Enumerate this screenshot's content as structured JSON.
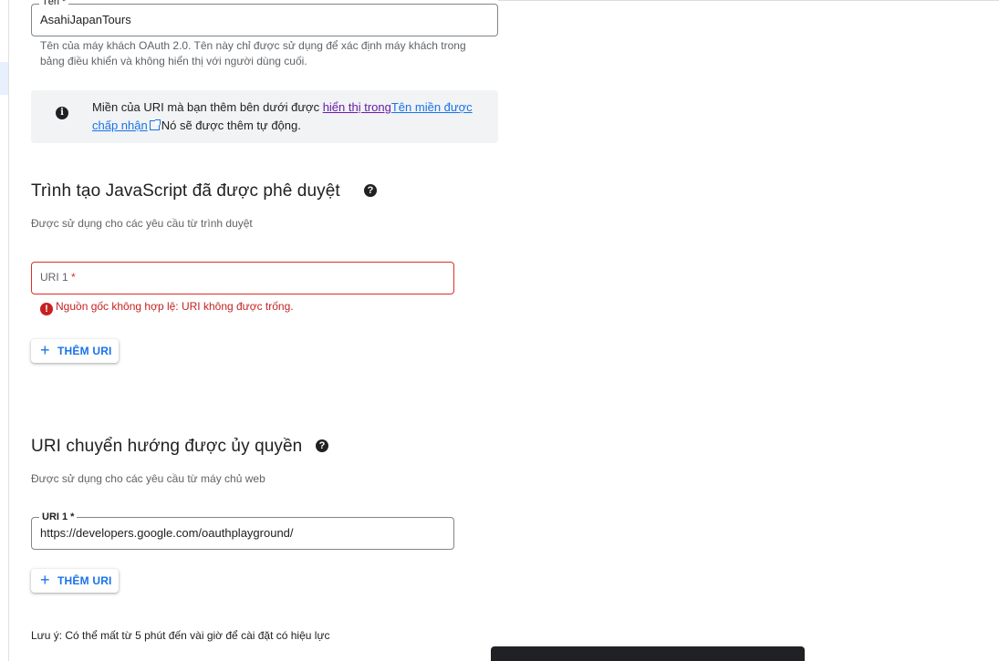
{
  "name_field": {
    "label": "Tên *",
    "value": "AsahiJapanTours",
    "hint": "Tên của máy khách OAuth 2.0. Tên này chỉ được sử dụng để xác định máy khách trong bảng điều khiển và không hiển thị với người dùng cuối."
  },
  "info_box": {
    "icon": "info-icon",
    "text_before": "Miền của URI mà bạn thêm bên dưới được ",
    "link1": "hiển thị trong",
    "link2": "Tên miền được chấp nhận",
    "text_after": "Nó sẽ được thêm tự động."
  },
  "js_origins": {
    "title": "Trình tạo JavaScript đã được phê duyệt",
    "help_icon": "?",
    "subtitle": "Được sử dụng cho các yêu cầu từ trình duyệt",
    "uri_label": "URI 1",
    "required_mark": "*",
    "error_icon": "!",
    "error_text": "Nguồn gốc không hợp lệ: URI không được trống.",
    "add_button": "THÊM URI",
    "add_icon": "+"
  },
  "redirect_uris": {
    "title": "URI chuyển hướng được ủy quyền",
    "help_icon": "?",
    "subtitle": "Được sử dụng cho các yêu cầu từ máy chủ web",
    "uri_label": "URI 1 *",
    "uri_value": "https://developers.google.com/oauthplayground/",
    "add_button": "THÊM URI",
    "add_icon": "+"
  },
  "note": "Lưu ý: Có thể mất từ 5 phút đến vài giờ để cài đặt có hiệu lực",
  "colors": {
    "accent": "#1a73e8",
    "error": "#d93025",
    "visited_link": "#681da8"
  }
}
